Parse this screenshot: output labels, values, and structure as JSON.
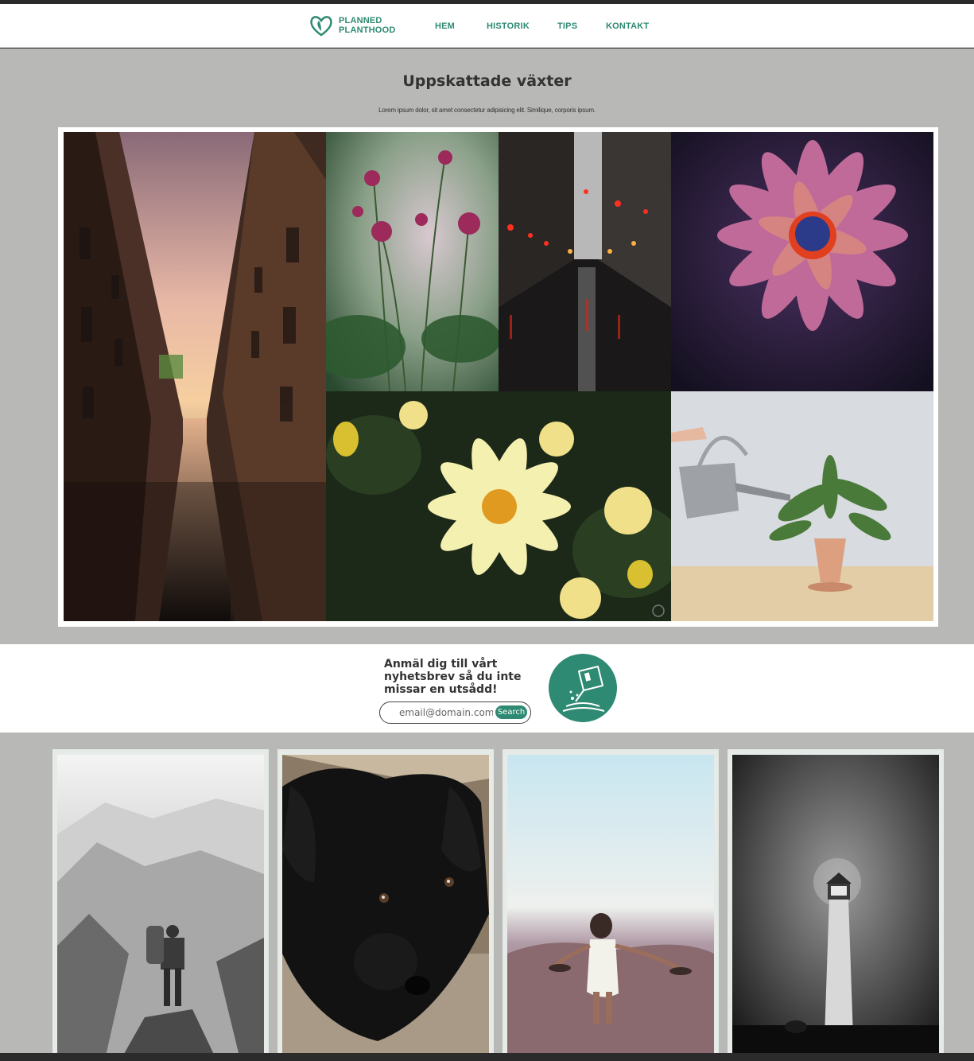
{
  "header": {
    "logo_line1": "PLANNED",
    "logo_line2": "PLANTHOOD",
    "nav": [
      "HEM",
      "HISTORIK",
      "TIPS",
      "KONTAKT"
    ]
  },
  "hero": {
    "title": "Uppskattade växter",
    "subtitle": "Lorem ipsum dolor, sit amet consectetur adipisicing elit. Similique, corporis ipsum."
  },
  "newsletter": {
    "text": "Anmäl dig till vårt nyhetsbrev så du inte missar en utsådd!",
    "placeholder": "email@domain.com",
    "button": "Search"
  },
  "colors": {
    "brand": "#2e8a72",
    "page_bg": "#b8b8b6"
  }
}
